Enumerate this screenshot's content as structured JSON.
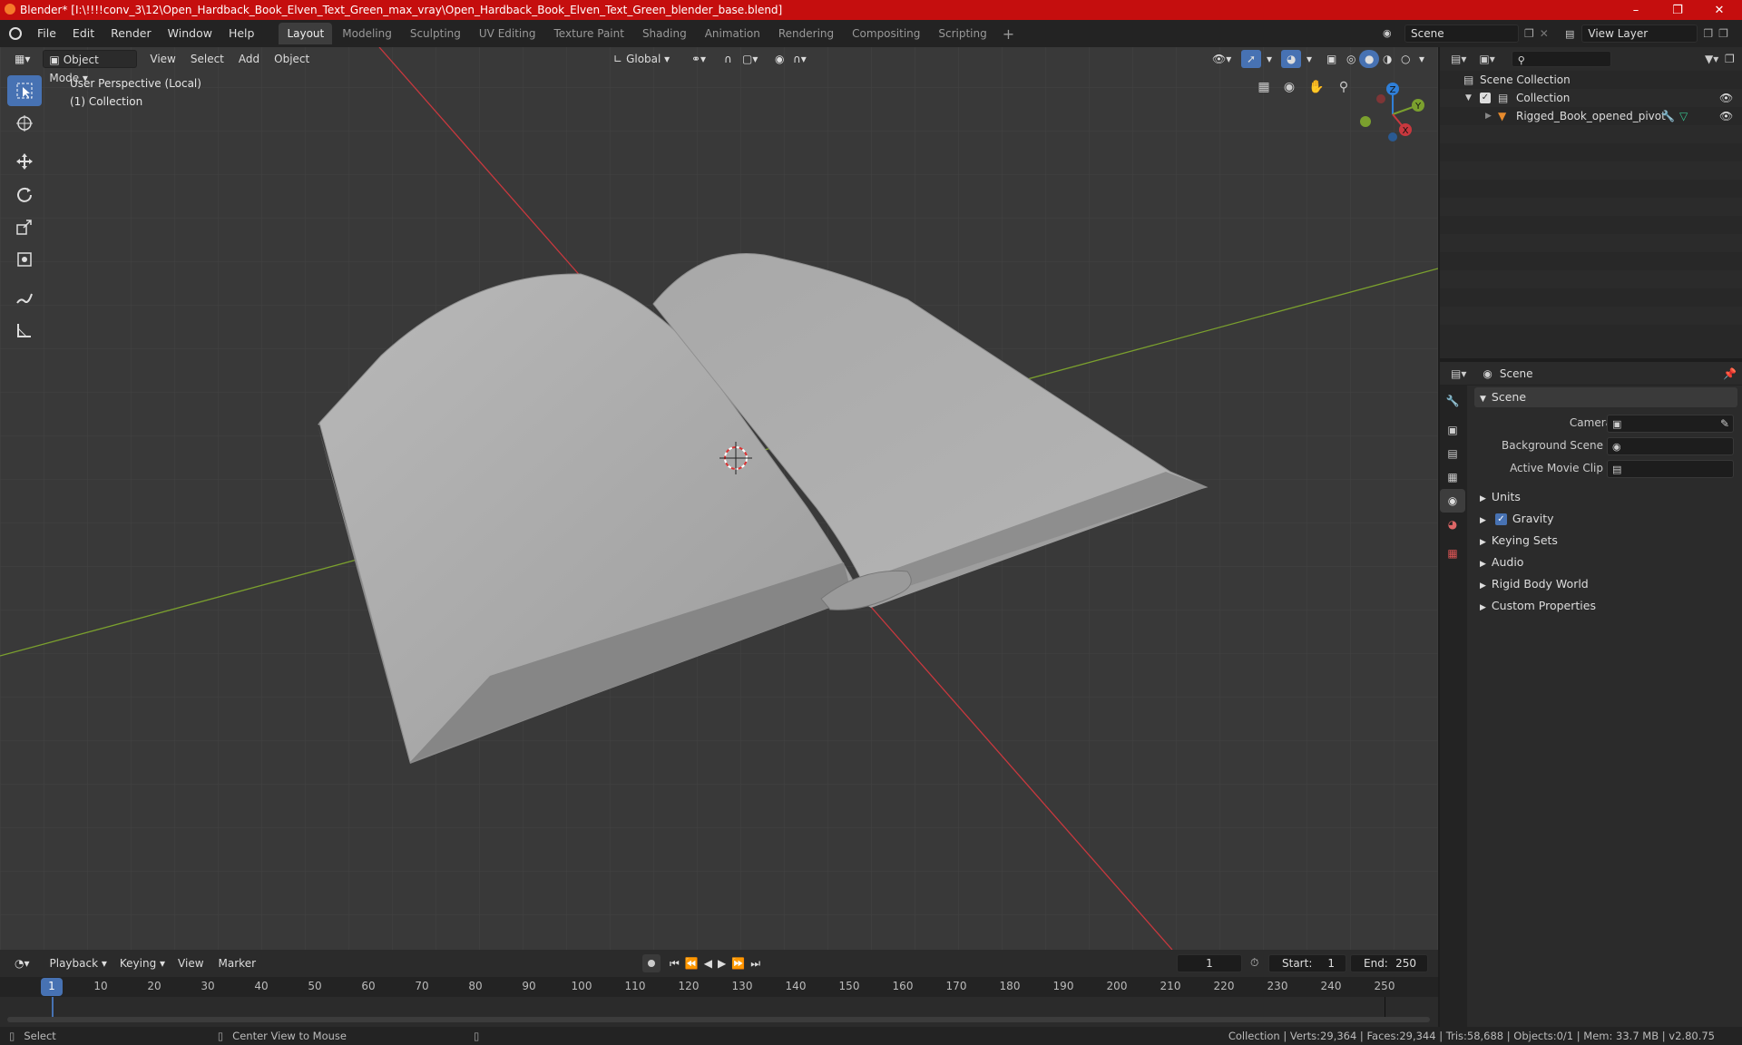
{
  "titlebar": {
    "title": "Blender* [I:\\!!!!conv_3\\12\\Open_Hardback_Book_Elven_Text_Green_max_vray\\Open_Hardback_Book_Elven_Text_Green_blender_base.blend]",
    "minimize": "–",
    "maximize": "❐",
    "close": "✕"
  },
  "menus": [
    "File",
    "Edit",
    "Render",
    "Window",
    "Help"
  ],
  "workspaces": [
    "Layout",
    "Modeling",
    "Sculpting",
    "UV Editing",
    "Texture Paint",
    "Shading",
    "Animation",
    "Rendering",
    "Compositing",
    "Scripting"
  ],
  "active_workspace": "Layout",
  "scene_selector": {
    "value": "Scene"
  },
  "view_layer_selector": {
    "value": "View Layer"
  },
  "viewport_header": {
    "mode": "Object Mode",
    "menus": [
      "View",
      "Select",
      "Add",
      "Object"
    ],
    "transform_orientation": "Global"
  },
  "viewport": {
    "perspective_label": "User Perspective (Local)",
    "collection_label": "(1) Collection",
    "gizmo": {
      "x": "X",
      "y": "Y",
      "z": "Z"
    }
  },
  "outliner": {
    "search_placeholder": "",
    "scene_collection": "Scene Collection",
    "collection": "Collection",
    "object": "Rigged_Book_opened_pivot"
  },
  "properties": {
    "header": "Scene",
    "panel_title": "Scene",
    "fields": [
      {
        "label": "Camera"
      },
      {
        "label": "Background Scene"
      },
      {
        "label": "Active Movie Clip"
      }
    ],
    "sections": [
      "Units",
      "Gravity",
      "Keying Sets",
      "Audio",
      "Rigid Body World",
      "Custom Properties"
    ],
    "gravity_checked": true
  },
  "timeline": {
    "menus": [
      "Playback",
      "Keying",
      "View",
      "Marker"
    ],
    "current_frame": "1",
    "start_label": "Start:",
    "start": "1",
    "end_label": "End:",
    "end": "250",
    "ruler": [
      "1",
      "10",
      "20",
      "30",
      "40",
      "50",
      "60",
      "70",
      "80",
      "90",
      "100",
      "110",
      "120",
      "130",
      "140",
      "150",
      "160",
      "170",
      "180",
      "190",
      "200",
      "210",
      "220",
      "230",
      "240",
      "250"
    ]
  },
  "statusbar": {
    "left_action": "Select",
    "middle_action": "Center View to Mouse",
    "stats": "Collection | Verts:29,364 | Faces:29,344 | Tris:58,688 | Objects:0/1 | Mem: 33.7 MB | v2.80.75"
  },
  "colors": {
    "titlebar": "#c50e0e",
    "accent": "#4772b3",
    "viewport_bg": "#393939",
    "x_axis": "#c8383e",
    "y_axis": "#7ba02e"
  }
}
